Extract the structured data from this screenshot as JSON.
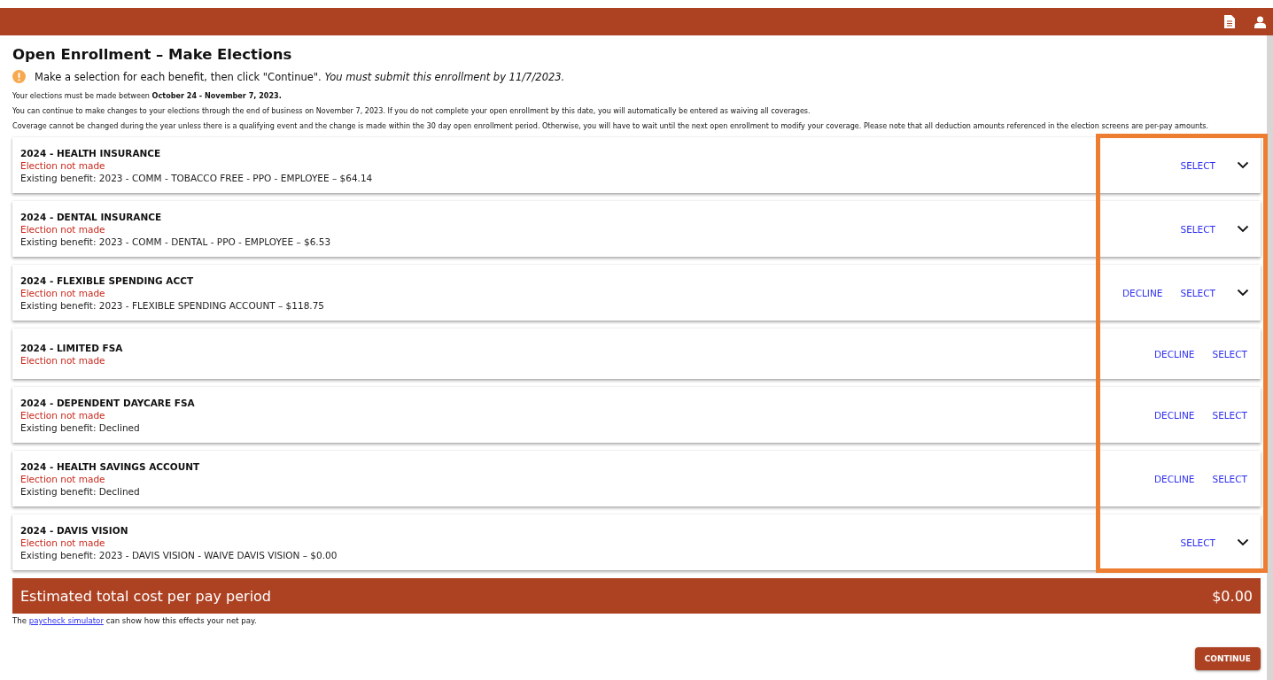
{
  "title": "Open Enrollment – Make Elections",
  "notice": {
    "text": "Make a selection for each benefit, then click \"Continue\". *You must submit this enrollment by 11/7/2023.*"
  },
  "paragraphs": [
    "Your elections must be made between **October 24 - November 7, 2023.**",
    "You can continue to make changes to your elections through the end of business on November 7, 2023. If you do not complete your open enrollment by this date, you will automatically be entered as waiving all coverages.",
    "Coverage cannot be changed during the year unless there is a qualifying event and the change is made within the 30 day open enrollment period. Otherwise, you will have to wait until the next open enrollment to modify your coverage. Please note that all deduction amounts referenced in the election screens are per-pay amounts."
  ],
  "benefits": [
    {
      "title": "2024 - HEALTH INSURANCE",
      "status": "Election not made",
      "existing": "Existing benefit: 2023 - COMM - TOBACCO FREE - PPO - EMPLOYEE – $64.14",
      "select": "SELECT",
      "expanded": false
    },
    {
      "title": "2024 - DENTAL INSURANCE",
      "status": "Election not made",
      "existing": "Existing benefit: 2023 - COMM - DENTAL - PPO - EMPLOYEE – $6.53",
      "select": "SELECT",
      "expanded": false
    },
    {
      "title": "2024 - FLEXIBLE SPENDING ACCT",
      "status": "Election not made",
      "existing": "Existing benefit: 2023 - FLEXIBLE SPENDING ACCOUNT – $118.75",
      "decline": "DECLINE",
      "select": "SELECT",
      "expanded": false
    },
    {
      "title": "2024 - LIMITED FSA",
      "status": "Election not made",
      "decline": "DECLINE",
      "select": "SELECT"
    },
    {
      "title": "2024 - DEPENDENT DAYCARE FSA",
      "status": "Election not made",
      "existing": "Existing benefit: Declined",
      "decline": "DECLINE",
      "select": "SELECT"
    },
    {
      "title": "2024 - HEALTH SAVINGS ACCOUNT",
      "status": "Election not made",
      "existing": "Existing benefit: Declined",
      "decline": "DECLINE",
      "select": "SELECT"
    },
    {
      "title": "2024 - DAVIS VISION",
      "status": "Election not made",
      "existing": "Existing benefit: 2023 - DAVIS VISION - WAIVE DAVIS VISION – $0.00",
      "select": "SELECT",
      "expanded": false
    }
  ],
  "highlight_actions": true,
  "total": {
    "label": "Estimated total cost per pay period",
    "amount": "$0.00"
  },
  "footnote": {
    "before": "The",
    "link": "paycheck simulator",
    "after": "can show how this effects your net pay."
  },
  "continue_button": "CONTINUE"
}
